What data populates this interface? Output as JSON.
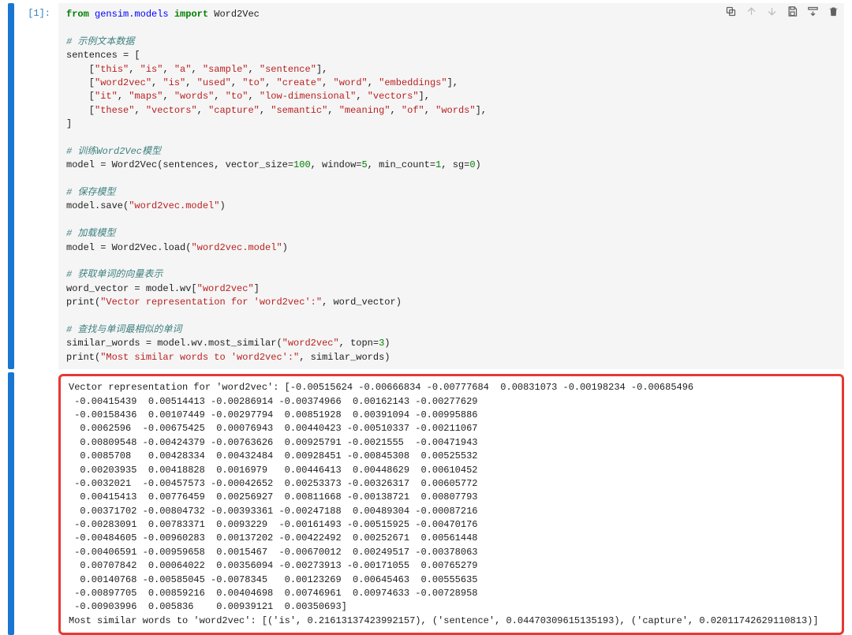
{
  "prompt": "[1]:",
  "code": {
    "line1_from": "from",
    "line1_mod": "gensim.models",
    "line1_import": "import",
    "line1_name": "Word2Vec",
    "comment1": "# 示例文本数据",
    "sent_open": "sentences = [",
    "s1a": "\"this\"",
    "s1b": "\"is\"",
    "s1c": "\"a\"",
    "s1d": "\"sample\"",
    "s1e": "\"sentence\"",
    "s2a": "\"word2vec\"",
    "s2b": "\"is\"",
    "s2c": "\"used\"",
    "s2d": "\"to\"",
    "s2e": "\"create\"",
    "s2f": "\"word\"",
    "s2g": "\"embeddings\"",
    "s3a": "\"it\"",
    "s3b": "\"maps\"",
    "s3c": "\"words\"",
    "s3d": "\"to\"",
    "s3e": "\"low-dimensional\"",
    "s3f": "\"vectors\"",
    "s4a": "\"these\"",
    "s4b": "\"vectors\"",
    "s4c": "\"capture\"",
    "s4d": "\"semantic\"",
    "s4e": "\"meaning\"",
    "s4f": "\"of\"",
    "s4g": "\"words\"",
    "sent_close": "]",
    "comment2": "# 训练Word2Vec模型",
    "train_line_head": "model = Word2Vec(sentences, vector_size=",
    "vs": "100",
    "train_mid1": ", window=",
    "win": "5",
    "train_mid2": ", min_count=",
    "mc": "1",
    "train_mid3": ", sg=",
    "sg": "0",
    "train_tail": ")",
    "comment3": "# 保存模型",
    "save_head": "model.save(",
    "save_str": "\"word2vec.model\"",
    "save_tail": ")",
    "comment4": "# 加载模型",
    "load_head": "model = Word2Vec.load(",
    "load_str": "\"word2vec.model\"",
    "load_tail": ")",
    "comment5": "# 获取单词的向量表示",
    "wv_head": "word_vector = model.wv[",
    "wv_str": "\"word2vec\"",
    "wv_tail": "]",
    "print1_head": "print(",
    "print1_str": "\"Vector representation for 'word2vec':\"",
    "print1_tail": ", word_vector)",
    "comment6": "# 查找与单词最相似的单词",
    "sim_head": "similar_words = model.wv.most_similar(",
    "sim_str": "\"word2vec\"",
    "sim_mid": ", topn=",
    "sim_n": "3",
    "sim_tail": ")",
    "print2_head": "print(",
    "print2_str": "\"Most similar words to 'word2vec':\"",
    "print2_tail": ", similar_words)"
  },
  "output": {
    "header": "Vector representation for 'word2vec': [-0.00515624 -0.00666834 -0.00777684  0.00831073 -0.00198234 -0.00685496",
    "rows": [
      " -0.00415439  0.00514413 -0.00286914 -0.00374966  0.00162143 -0.00277629",
      " -0.00158436  0.00107449 -0.00297794  0.00851928  0.00391094 -0.00995886",
      "  0.0062596  -0.00675425  0.00076943  0.00440423 -0.00510337 -0.00211067",
      "  0.00809548 -0.00424379 -0.00763626  0.00925791 -0.0021555  -0.00471943",
      "  0.0085708   0.00428334  0.00432484  0.00928451 -0.00845308  0.00525532",
      "  0.00203935  0.00418828  0.0016979   0.00446413  0.00448629  0.00610452",
      " -0.0032021  -0.00457573 -0.00042652  0.00253373 -0.00326317  0.00605772",
      "  0.00415413  0.00776459  0.00256927  0.00811668 -0.00138721  0.00807793",
      "  0.00371702 -0.00804732 -0.00393361 -0.00247188  0.00489304 -0.00087216",
      " -0.00283091  0.00783371  0.0093229  -0.00161493 -0.00515925 -0.00470176",
      " -0.00484605 -0.00960283  0.00137202 -0.00422492  0.00252671  0.00561448",
      " -0.00406591 -0.00959658  0.0015467  -0.00670012  0.00249517 -0.00378063",
      "  0.00707842  0.00064022  0.00356094 -0.00273913 -0.00171055  0.00765279",
      "  0.00140768 -0.00585045 -0.0078345   0.00123269  0.00645463  0.00555635",
      " -0.00897705  0.00859216  0.00404698  0.00746961  0.00974633 -0.00728958",
      " -0.00903996  0.005836    0.00939121  0.00350693]"
    ],
    "footer": "Most similar words to 'word2vec': [('is', 0.21613137423992157), ('sentence', 0.04470309615135193), ('capture', 0.02011742629110813)]"
  },
  "toolbar": {
    "copy": "copy-icon",
    "up": "arrow-up-icon",
    "down": "arrow-down-icon",
    "save": "save-icon",
    "insert": "insert-below-icon",
    "delete": "trash-icon"
  }
}
